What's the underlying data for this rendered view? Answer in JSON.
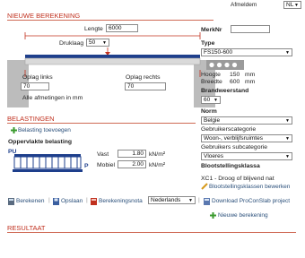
{
  "top": {
    "language_label": "Afmeldem",
    "language_value": "NL"
  },
  "new_calc": {
    "title": "NIEUWE BEREKENING",
    "length_label": "Lengte",
    "length_value": "6000",
    "bearing_label": "Druklaag",
    "bearing_value": "50",
    "support_left_label": "Oplag links",
    "support_left_value": "70",
    "support_right_label": "Oplag rechts",
    "support_right_value": "70",
    "units_note": "Alle afmetingen in mm"
  },
  "right_panel": {
    "mark_label": "MerkNr",
    "mark_value": "",
    "type_label": "Type",
    "type_value": "FS150-600",
    "height_label": "Hoogte",
    "height_value": "150",
    "height_unit": "mm",
    "width_label": "Breedte",
    "width_value": "600",
    "width_unit": "mm",
    "fire_label": "Brandweerstand",
    "fire_value": "60",
    "norm_label": "Norm",
    "norm_value": "Belgie",
    "usage_label": "Gebruikerscategorie",
    "usage_value": "Woon-, verblijfsruimtes",
    "sub_label": "Gebruikers subcategorie",
    "sub_value": "Vloeres",
    "exposure_title": "Blootstellingsklassa",
    "exposure_value": "XC1 - Droog of blijvend nat",
    "exposure_edit": "Blootstellingsklassen bewerken",
    "new_calc_link": "Nieuwe berekening"
  },
  "loads": {
    "title": "BELASTINGEN",
    "add_link": "Belasting toevoegen",
    "surface_title": "Oppervlakte belasting",
    "pu_label": "PU",
    "p_label": "P",
    "fixed_label": "Vast",
    "fixed_value": "1.80",
    "fixed_unit": "kN/m²",
    "mobile_label": "Mobiel",
    "mobile_value": "2.00",
    "mobile_unit": "kN/m²"
  },
  "toolbar": {
    "calculate": "Berekenen",
    "save": "Opslaan",
    "calc_note": "Berekeningsnota",
    "language": "Nederlands",
    "download": "Download ProConSlab project"
  },
  "result": {
    "title": "RESULTAAT"
  }
}
